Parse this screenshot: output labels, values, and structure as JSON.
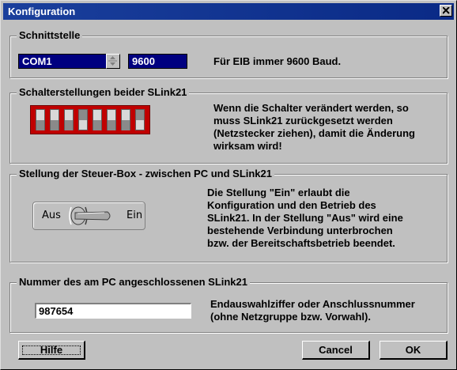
{
  "window": {
    "title": "Konfiguration"
  },
  "schnittstelle": {
    "legend": "Schnittstelle",
    "port": "COM1",
    "baud": "9600",
    "hint": "Für EIB immer 9600 Baud."
  },
  "schalter": {
    "legend": "Schalterstellungen beider SLink21",
    "text": [
      "Wenn die Schalter verändert werden, so",
      "muss SLink21 zurückgesetzt werden",
      "(Netzstecker ziehen), damit die Änderung",
      "wirksam wird!"
    ]
  },
  "steuer": {
    "legend": "Stellung der Steuer-Box - zwischen PC und SLink21",
    "aus": "Aus",
    "ein": "Ein",
    "text": [
      "Die Stellung \"Ein\" erlaubt die",
      "Konfiguration und den Betrieb des",
      "SLink21. In der Stellung \"Aus\" wird eine",
      "bestehende Verbindung unterbrochen",
      "bzw. der Bereitschaftsbetrieb beendet."
    ]
  },
  "nummer": {
    "legend": "Nummer des am PC angeschlossenen SLink21",
    "value": "987654",
    "text": [
      "Endauswahlziffer oder Anschlussnummer",
      "(ohne Netzgruppe bzw. Vorwahl)."
    ]
  },
  "buttons": {
    "help": "Hilfe",
    "cancel": "Cancel",
    "ok": "OK"
  }
}
